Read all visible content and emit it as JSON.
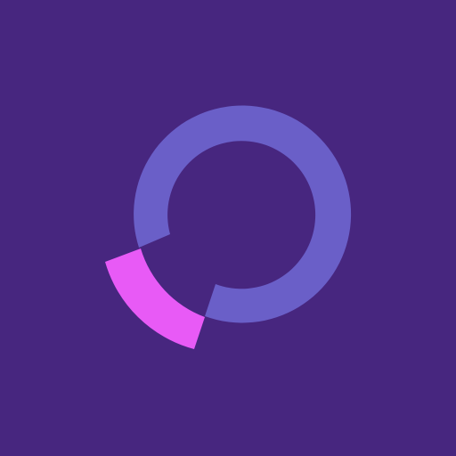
{
  "icon": {
    "name": "circular-logo-mark",
    "colors": {
      "background": "#47267F",
      "ring": "#6A5FC8",
      "accent_segment": "#E85AF6"
    }
  }
}
